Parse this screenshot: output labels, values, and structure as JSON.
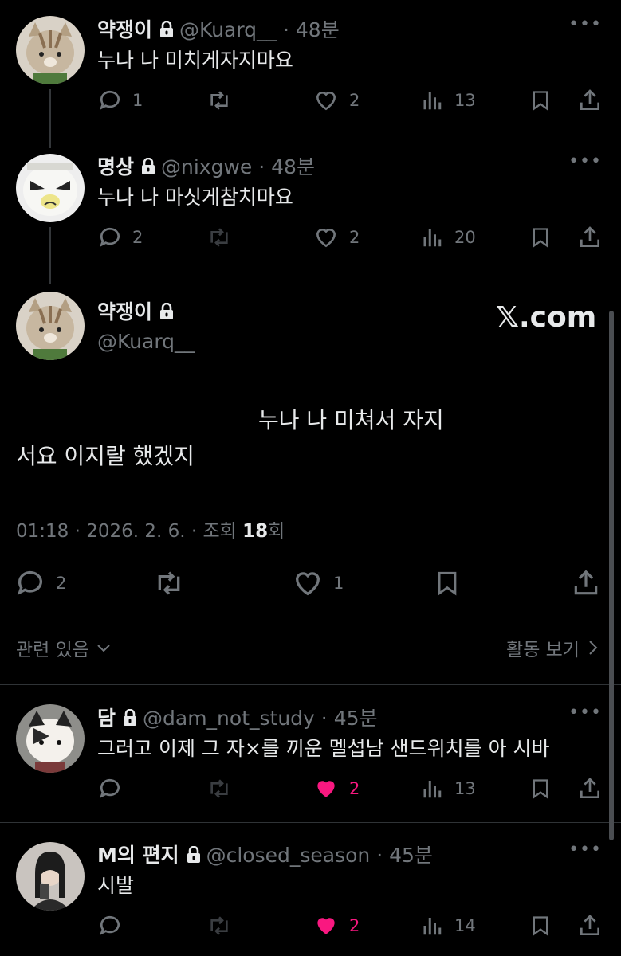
{
  "tweets": [
    {
      "name": "약쟁이",
      "handle": "@Kuarq__",
      "time": "48분",
      "text": "누나 나 미치게자지마요",
      "replies": "1",
      "retweets": "",
      "likes": "2",
      "views": "13",
      "liked": false
    },
    {
      "name": "명상",
      "handle": "@nixgwe",
      "time": "48분",
      "text": "누나 나 마싯게참치마요",
      "replies": "2",
      "retweets": "",
      "likes": "2",
      "views": "20",
      "liked": false
    }
  ],
  "main": {
    "name": "약쟁이",
    "handle": "@Kuarq__",
    "watermark": "𝕏.com",
    "text_line1": "누나 나 미쳐서 자지",
    "text_line2": "서요 이지랄 했겠지",
    "meta_time": "01:18 · 2026. 2. 6. · 조회 ",
    "meta_views": "18",
    "meta_views_suffix": "회",
    "replies": "2",
    "likes": "1"
  },
  "related": {
    "left_label": "관련 있음",
    "right_label": "활동 보기"
  },
  "replies": [
    {
      "name": "담",
      "handle": "@dam_not_study",
      "time": "45분",
      "text": "그러고 이제 그 자×를 끼운 멜섭남 샌드위치를 아 시바",
      "replies": "",
      "likes": "2",
      "views": "13",
      "liked": true
    },
    {
      "name": "M의 편지",
      "handle": "@closed_season",
      "time": "45분",
      "text": "시발",
      "replies": "",
      "likes": "2",
      "views": "14",
      "liked": true
    }
  ],
  "colors": {
    "background": "#000000",
    "text": "#e7e9ea",
    "muted": "#71767b",
    "like": "#f91880",
    "divider": "#2f3336"
  },
  "icons": [
    "reply-icon",
    "retweet-icon",
    "like-icon",
    "views-icon",
    "bookmark-icon",
    "share-icon",
    "lock-icon",
    "more-icon",
    "chevron-down-icon",
    "chevron-right-icon"
  ]
}
